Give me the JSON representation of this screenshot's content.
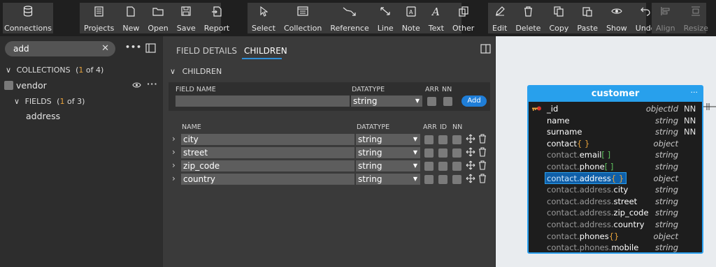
{
  "toolbar": {
    "connections": "Connections",
    "projects": "Projects",
    "new": "New",
    "open": "Open",
    "save": "Save",
    "report": "Report",
    "select": "Select",
    "collection": "Collection",
    "reference": "Reference",
    "line": "Line",
    "note": "Note",
    "text": "Text",
    "other": "Other",
    "edit": "Edit",
    "delete": "Delete",
    "copy": "Copy",
    "paste": "Paste",
    "show": "Show",
    "undo": "Undo",
    "align": "Align",
    "resize": "Resize"
  },
  "left": {
    "search_value": "add",
    "collections_label": "COLLECTIONS",
    "collections_count_open": "(",
    "collections_count": "1",
    "collections_count_rest": "of 4)",
    "vendor": "vendor",
    "fields_label": "FIELDS",
    "fields_count": "1",
    "fields_count_rest": "of 3)",
    "address": "address"
  },
  "mid": {
    "tab_details": "FIELD DETAILS",
    "tab_children": "CHILDREN",
    "children_header": "CHILDREN",
    "add": {
      "field_name_label": "FIELD NAME",
      "datatype_label": "DATATYPE",
      "arr_label": "ARR",
      "nn_label": "NN",
      "datatype_value": "string",
      "add_button": "Add"
    },
    "list_headers": {
      "name": "NAME",
      "datatype": "DATATYPE",
      "arr": "ARR",
      "id": "ID",
      "nn": "NN"
    },
    "rows": [
      {
        "name": "city",
        "datatype": "string"
      },
      {
        "name": "street",
        "datatype": "string"
      },
      {
        "name": "zip_code",
        "datatype": "string"
      },
      {
        "name": "country",
        "datatype": "string"
      }
    ]
  },
  "entity": {
    "title": "customer",
    "rows": [
      {
        "prefix": "",
        "name": "_id",
        "suffix": "",
        "type": "objectId",
        "nn": "NN",
        "key": true
      },
      {
        "prefix": "",
        "name": "name",
        "suffix": "",
        "type": "string",
        "nn": "NN"
      },
      {
        "prefix": "",
        "name": "surname",
        "suffix": "",
        "type": "string",
        "nn": "NN"
      },
      {
        "prefix": "",
        "name": "contact",
        "suffix": "{ }",
        "type": "object",
        "nn": ""
      },
      {
        "prefix": "contact.",
        "name": "email",
        "suffix": "[ ]",
        "type": "string",
        "nn": ""
      },
      {
        "prefix": "contact.",
        "name": "phone",
        "suffix": "[ ]",
        "type": "string",
        "nn": ""
      },
      {
        "prefix": "contact.",
        "name": "address",
        "suffix": "{ }",
        "type": "object",
        "nn": "",
        "selected": true
      },
      {
        "prefix": "contact.address.",
        "name": "city",
        "suffix": "",
        "type": "string",
        "nn": ""
      },
      {
        "prefix": "contact.address.",
        "name": "street",
        "suffix": "",
        "type": "string",
        "nn": ""
      },
      {
        "prefix": "contact.address.",
        "name": "zip_code",
        "suffix": "",
        "type": "string",
        "nn": ""
      },
      {
        "prefix": "contact.address.",
        "name": "country",
        "suffix": "",
        "type": "string",
        "nn": ""
      },
      {
        "prefix": "contact.",
        "name": "phones",
        "suffix": "{}",
        "type": "object",
        "nn": ""
      },
      {
        "prefix": "contact.phones.",
        "name": "mobile",
        "suffix": "",
        "type": "string",
        "nn": ""
      }
    ]
  },
  "colors": {
    "accent": "#28a0ec",
    "count": "#e8a33c",
    "array_bracket": "#5ec25e"
  }
}
